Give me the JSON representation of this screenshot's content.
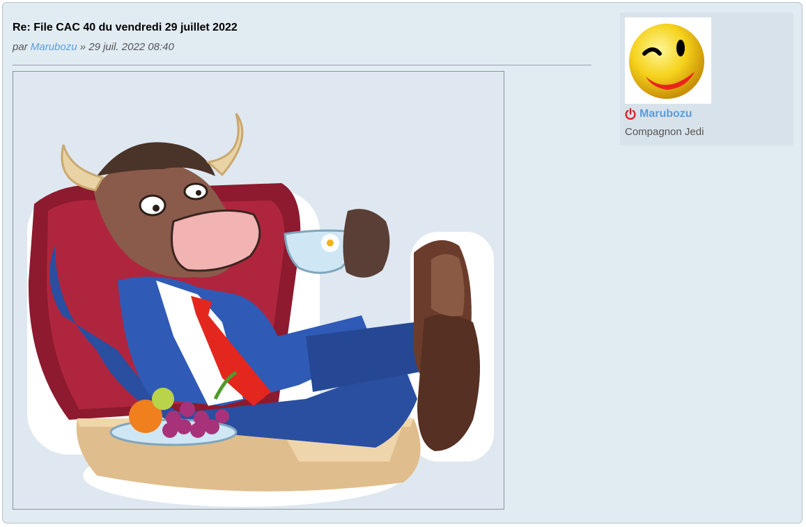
{
  "post": {
    "title": "Re: File CAC 40 du vendredi 29 juillet 2022",
    "meta_prefix": "par",
    "author": "Marubozu",
    "meta_suffix": "» 29 juil. 2022 08:40"
  },
  "attachment": {
    "image_icon": "bull-cartoon-sticker"
  },
  "profile": {
    "username": "Marubozu",
    "rank": "Compagnon Jedi",
    "avatar_icon": "winking-smiley-icon",
    "status_icon": "power-icon",
    "status_color": "#e02020"
  },
  "colors": {
    "post_background": "#e1ebf2",
    "link": "#5b9dd9",
    "profile_background": "#d8e2ea"
  }
}
